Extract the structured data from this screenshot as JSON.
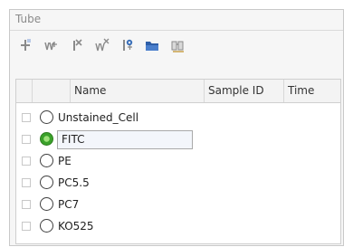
{
  "panel": {
    "title": "Tube"
  },
  "toolbar": {
    "buttons": [
      {
        "icon": "add-tube-icon"
      },
      {
        "icon": "add-multiple-tubes-icon"
      },
      {
        "icon": "delete-tube-icon"
      },
      {
        "icon": "delete-multiple-tubes-icon"
      },
      {
        "icon": "tube-settings-icon"
      },
      {
        "icon": "open-folder-icon"
      },
      {
        "icon": "find-icon"
      }
    ]
  },
  "grid": {
    "columns": [
      "Name",
      "Sample ID",
      "Time"
    ],
    "rows": [
      {
        "name": "Unstained_Cell",
        "selected": false
      },
      {
        "name": "FITC",
        "selected": true
      },
      {
        "name": "PE",
        "selected": false
      },
      {
        "name": "PC5.5",
        "selected": false
      },
      {
        "name": "PC7",
        "selected": false
      },
      {
        "name": "KO525",
        "selected": false
      }
    ]
  },
  "colors": {
    "accent": "#3aa12a",
    "icon_blue": "#3a6fb8"
  }
}
